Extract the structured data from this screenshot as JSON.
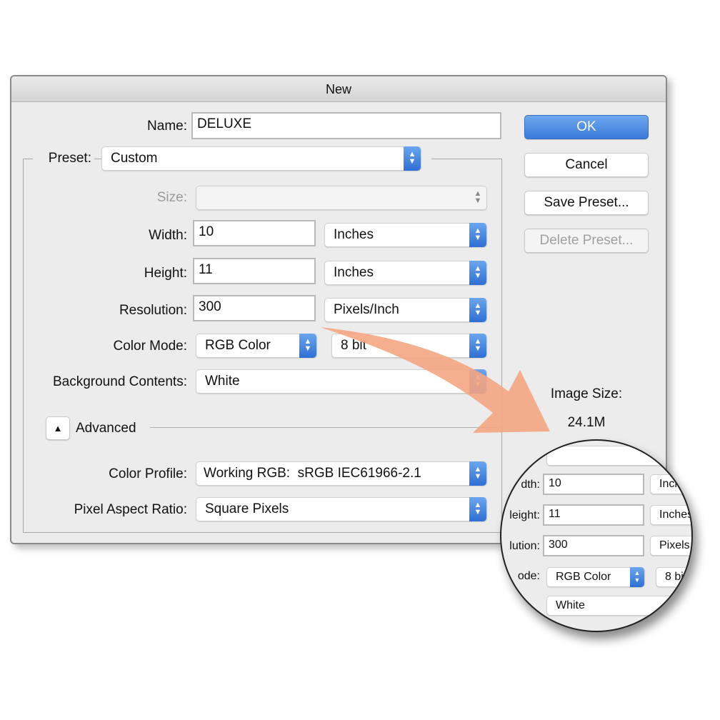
{
  "dialog": {
    "title": "New",
    "name_label": "Name:",
    "name_value": "DELUXE",
    "preset_label": "Preset:",
    "preset_value": "Custom",
    "size_label": "Size:",
    "size_value": "",
    "width_label": "Width:",
    "width_value": "10",
    "width_unit": "Inches",
    "height_label": "Height:",
    "height_value": "11",
    "height_unit": "Inches",
    "resolution_label": "Resolution:",
    "resolution_value": "300",
    "resolution_unit": "Pixels/Inch",
    "color_mode_label": "Color Mode:",
    "color_mode_value": "RGB Color",
    "bit_depth_value": "8 bit",
    "background_label": "Background Contents:",
    "background_value": "White",
    "advanced_label": "Advanced",
    "color_profile_label": "Color Profile:",
    "color_profile_value": "Working RGB:  sRGB IEC61966-2.1",
    "pixel_aspect_label": "Pixel Aspect Ratio:",
    "pixel_aspect_value": "Square Pixels",
    "buttons": {
      "ok": "OK",
      "cancel": "Cancel",
      "save_preset": "Save Preset...",
      "delete_preset": "Delete Preset..."
    },
    "image_size_label": "Image Size:",
    "image_size_value": "24.1M"
  },
  "magnifier": {
    "width_label": "dth:",
    "width_value": "10",
    "width_unit": "Inch",
    "height_label": "leight:",
    "height_value": "11",
    "height_unit": "Inches",
    "resolution_label": "lution:",
    "resolution_value": "300",
    "resolution_unit": "Pixels",
    "mode_label": "ode:",
    "mode_value": "RGB Color",
    "bit_value": "8 bi",
    "background_value": "White"
  },
  "colors": {
    "accent": "#3a7ad9",
    "arrow": "#f4a582"
  }
}
